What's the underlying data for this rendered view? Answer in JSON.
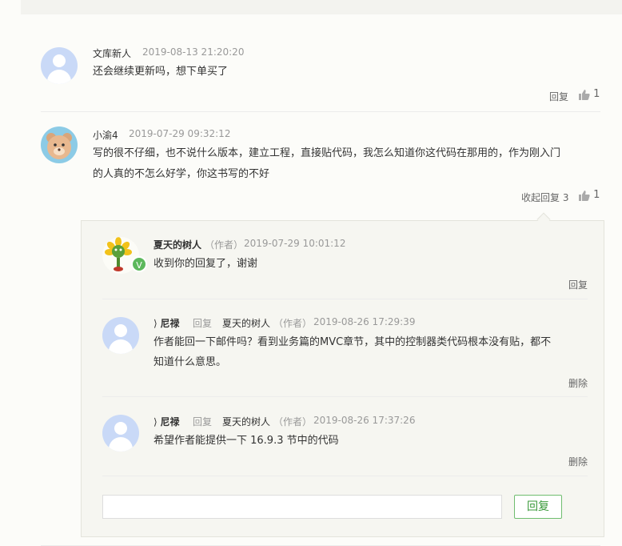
{
  "comments": [
    {
      "author": "文库新人",
      "time": "2019-08-13 21:20:20",
      "lines": [
        "还会继续更新吗，想下单买了"
      ],
      "reply_label": "回复",
      "likes": "1"
    },
    {
      "author": "小渝4",
      "time": "2019-07-29 09:32:12",
      "lines": [
        "写的很不仔细，也不说什么版本，建立工程，直接贴代码，我怎么知道你这代码在那用的，作为刚入门",
        "的人真的不怎么好学，你这书写的不好"
      ],
      "collapse_label": "收起回复 3",
      "likes": "1"
    }
  ],
  "replies": [
    {
      "author": "夏天的树人",
      "author_tag": "（作者）",
      "time": "2019-07-29 10:01:12",
      "text": "收到你的回复了，谢谢",
      "action": "回复",
      "badge": "V"
    },
    {
      "author": "尼禄",
      "reply_word": "回复",
      "reply_to": "夏天的树人",
      "reply_to_tag": "（作者）",
      "time": "2019-08-26 17:29:39",
      "lines": [
        "作者能回一下邮件吗？看到业务篇的MVC章节，其中的控制器类代码根本没有贴，都不",
        "知道什么意思。"
      ],
      "action": "删除"
    },
    {
      "author": "尼禄",
      "reply_word": "回复",
      "reply_to": "夏天的树人",
      "reply_to_tag": "（作者）",
      "time": "2019-08-26 17:37:26",
      "text": "希望作者能提供一下 16.9.3 节中的代码",
      "action": "删除"
    }
  ],
  "reply_input": {
    "value": "",
    "placeholder": ""
  },
  "reply_button": "回复",
  "icons": {
    "like": "thumbs-up-icon",
    "user": "user-avatar-icon",
    "arrow": "arrow-icon"
  },
  "colors": {
    "accent_green": "#5cb85c",
    "button_border": "#6fbd6f"
  }
}
